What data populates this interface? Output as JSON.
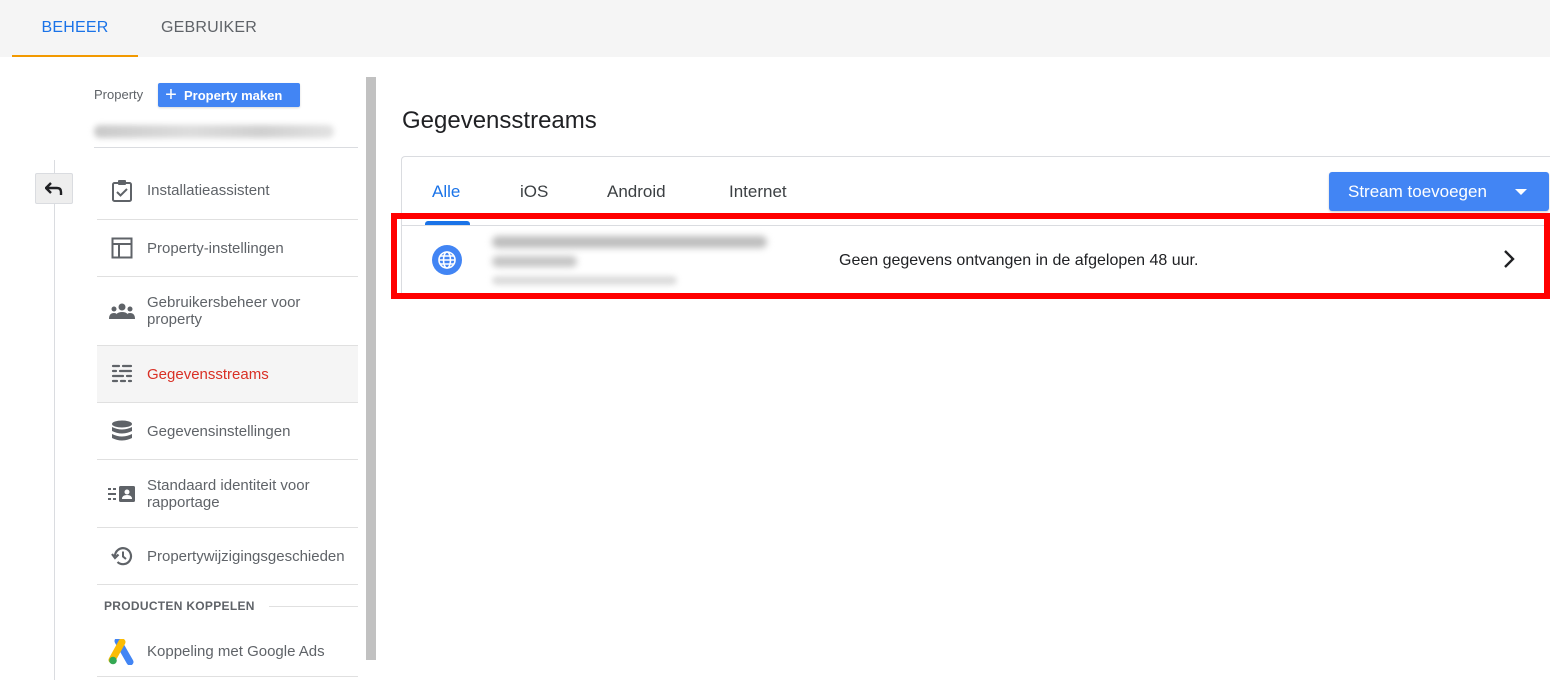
{
  "top_tabs": {
    "beheer": "BEHEER",
    "gebruiker": "GEBRUIKER"
  },
  "property": {
    "label": "Property",
    "create_button": "Property maken",
    "create_icon": "plus-icon"
  },
  "menu": [
    {
      "label": "Installatieassistent",
      "icon": "clipboard-check-icon"
    },
    {
      "label": "Property-instellingen",
      "icon": "layout-icon"
    },
    {
      "label": "Gebruikersbeheer voor property",
      "icon": "people-icon"
    },
    {
      "label": "Gegevensstreams",
      "icon": "streams-icon",
      "active": true
    },
    {
      "label": "Gegevensinstellingen",
      "icon": "database-icon"
    },
    {
      "label": "Standaard identiteit voor rapportage",
      "icon": "identity-icon"
    },
    {
      "label": "Propertywijzigingsgeschieden",
      "icon": "history-icon"
    }
  ],
  "linking": {
    "heading": "PRODUCTEN KOPPELEN",
    "items": [
      {
        "label": "Koppeling met Google Ads",
        "icon": "google-ads-icon"
      }
    ]
  },
  "main": {
    "title": "Gegevensstreams",
    "tabs": [
      "Alle",
      "iOS",
      "Android",
      "Internet"
    ],
    "active_tab": "Alle",
    "add_button": "Stream toevoegen",
    "stream": {
      "icon": "globe-icon",
      "status": "Geen gegevens ontvangen in de afgelopen 48 uur."
    }
  },
  "colors": {
    "accent_blue": "#1a73e8",
    "button_blue": "#4285f4",
    "active_red": "#d93025",
    "tab_underline_orange": "#f29900",
    "highlight_red": "#ff0000"
  }
}
